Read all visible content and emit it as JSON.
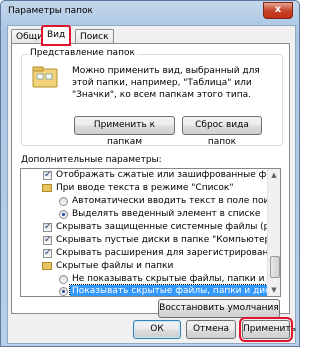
{
  "window": {
    "title": "Параметры папок",
    "close": "x"
  },
  "tabs": [
    "Общие",
    "Вид",
    "Поиск"
  ],
  "folder_view": {
    "group_title": "Представление папок",
    "text": "Можно применить вид, выбранный для этой папки, например, \"Таблица\" или \"Значки\", ко всем папкам этого типа.",
    "apply_button": "Применить к папкам",
    "reset_button": "Сброс вида папок"
  },
  "advanced": {
    "label": "Дополнительные параметры:",
    "rows": [
      {
        "kind": "checkbox",
        "checked": true,
        "text": "Отображать сжатые или зашифрованные файлы NTI"
      },
      {
        "kind": "folder",
        "text": "При вводе текста в режиме \"Список\""
      },
      {
        "kind": "radio",
        "checked": false,
        "text": "Автоматически вводить текст в поле поиска"
      },
      {
        "kind": "radio",
        "checked": true,
        "text": "Выделять введенный элемент в списке"
      },
      {
        "kind": "checkbox",
        "checked": true,
        "text": "Скрывать защищенные системные файлы (рекомен"
      },
      {
        "kind": "checkbox",
        "checked": true,
        "text": "Скрывать пустые диски в папке \"Компьютер\""
      },
      {
        "kind": "checkbox",
        "checked": true,
        "text": "Скрывать расширения для зарегистрированных типо"
      },
      {
        "kind": "folder",
        "text": "Скрытые файлы и папки"
      },
      {
        "kind": "radio",
        "checked": false,
        "text": "Не показывать скрытые файлы, папки и диски"
      },
      {
        "kind": "radio",
        "checked": true,
        "text": "Показывать скрытые файлы, папки и диски"
      }
    ],
    "restore_button": "Восстановить умолчания"
  },
  "footer": {
    "ok": "ОК",
    "cancel": "Отмена",
    "apply": "Применить"
  }
}
